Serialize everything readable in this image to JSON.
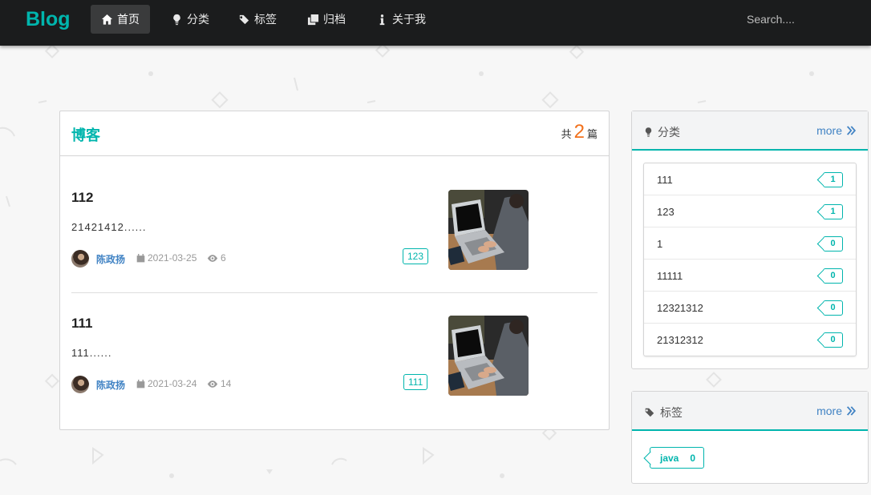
{
  "navbar": {
    "brand": "Blog",
    "items": [
      {
        "label": "首页",
        "icon": "home-icon",
        "active": true
      },
      {
        "label": "分类",
        "icon": "lightbulb-icon"
      },
      {
        "label": "标签",
        "icon": "tags-icon"
      },
      {
        "label": "归档",
        "icon": "clone-icon"
      },
      {
        "label": "关于我",
        "icon": "info-icon"
      }
    ],
    "search_placeholder": "Search...."
  },
  "main": {
    "title": "博客",
    "total_prefix": "共",
    "total_count": "2",
    "total_suffix": "篇",
    "posts": [
      {
        "title": "112",
        "excerpt": "21421412......",
        "author": "陈政扬",
        "date": "2021-03-25",
        "views": "6",
        "tag": "123"
      },
      {
        "title": "111",
        "excerpt": "111......",
        "author": "陈政扬",
        "date": "2021-03-24",
        "views": "14",
        "tag": "111"
      }
    ]
  },
  "sidebar": {
    "categories": {
      "title": "分类",
      "more": "more",
      "items": [
        {
          "name": "111",
          "count": "1"
        },
        {
          "name": "123",
          "count": "1"
        },
        {
          "name": "1",
          "count": "0"
        },
        {
          "name": "11111",
          "count": "0"
        },
        {
          "name": "12321312",
          "count": "0"
        },
        {
          "name": "21312312",
          "count": "0"
        }
      ]
    },
    "tags": {
      "title": "标签",
      "more": "more",
      "items": [
        {
          "name": "java",
          "count": "0"
        }
      ]
    }
  },
  "colors": {
    "accent": "#00b5ad",
    "link": "#4183c4",
    "highlight": "#f2711c",
    "navbar_bg": "#1b1c1d"
  }
}
